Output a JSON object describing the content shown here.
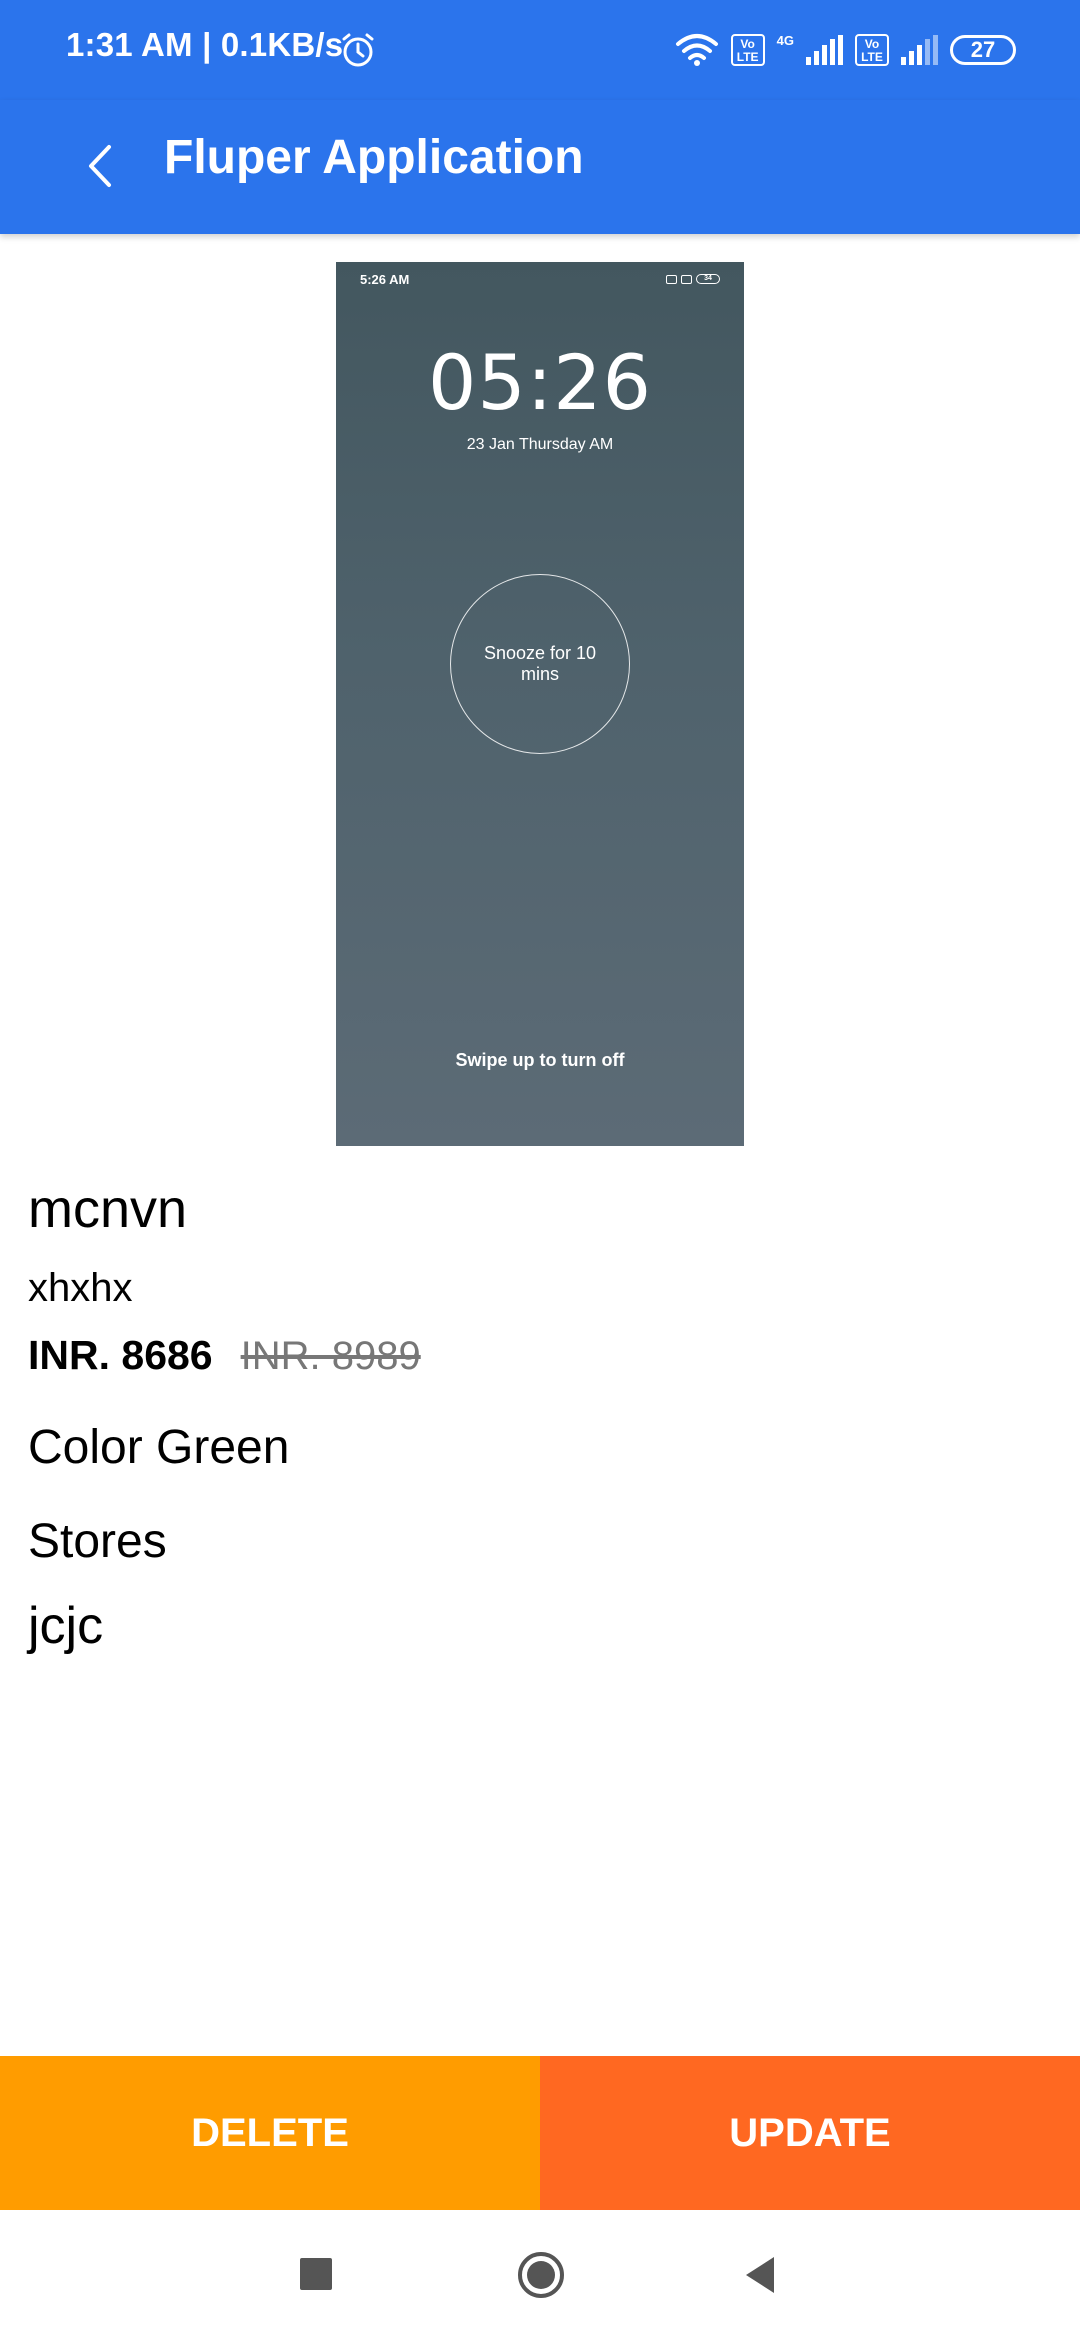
{
  "status_bar": {
    "time": "1:31 AM | 0.1KB/s",
    "network": "4G",
    "volte": "Vo LTE",
    "battery": "27",
    "icons": [
      "alarm-icon",
      "wifi-icon",
      "volte-icon",
      "signal-icon",
      "battery-icon"
    ]
  },
  "app_bar": {
    "title": "Fluper Application",
    "back_icon": "back-arrow-icon"
  },
  "product_image": {
    "status_time": "5:26 AM",
    "battery": "34",
    "clock": "05:26",
    "date": "23 Jan Thursday AM",
    "snooze": "Snooze for 10 mins",
    "swipe": "Swipe up to turn off"
  },
  "product": {
    "name": "mcnvn",
    "subtitle": "xhxhx",
    "price": "INR. 8686",
    "original_price": "INR. 8989",
    "color": "Color Green",
    "stores_label": "Stores",
    "store": "jcjc"
  },
  "actions": {
    "delete": "DELETE",
    "update": "UPDATE"
  },
  "colors": {
    "primary": "#2B74EC",
    "delete": "#FF9C00",
    "update": "#FF6821"
  },
  "nav_bar": {
    "icons": [
      "recents-icon",
      "home-icon",
      "back-icon"
    ]
  }
}
